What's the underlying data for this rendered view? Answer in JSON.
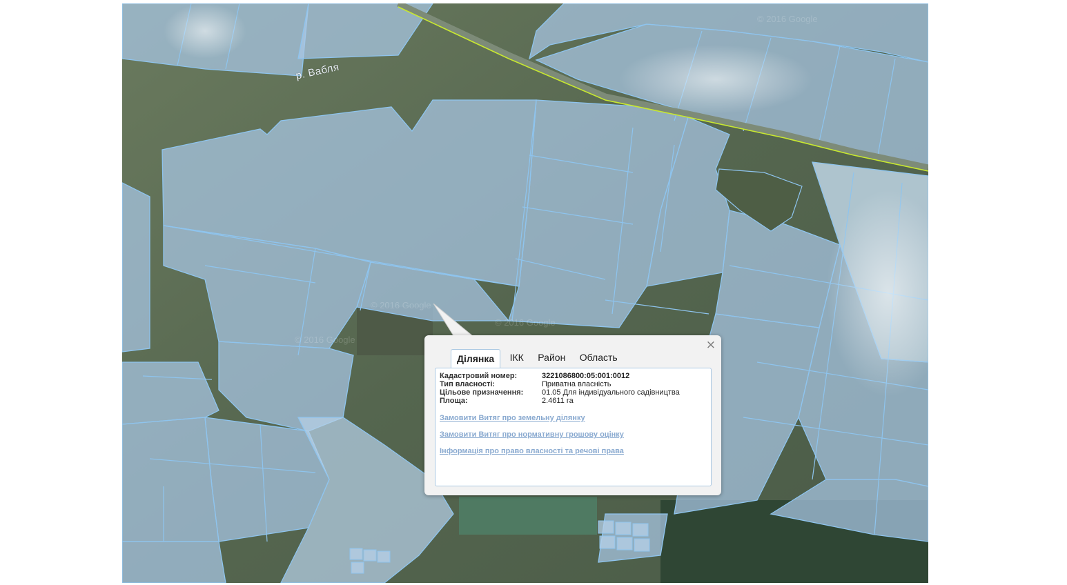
{
  "map": {
    "river_label": "р. Вабля",
    "watermarks": [
      "© 2016 Google",
      "© 2016 Google",
      "© 2016 Google",
      "© 2016 Google"
    ],
    "colors": {
      "parcel_fill": "#a9c8e6",
      "parcel_stroke": "#8ec4ee",
      "road_line": "#c8e830",
      "imagery_dark": "#5b6a55"
    }
  },
  "popup": {
    "close_label": "×",
    "tabs": [
      {
        "label": "Ділянка",
        "active": true
      },
      {
        "label": "ІКК",
        "active": false
      },
      {
        "label": "Район",
        "active": false
      },
      {
        "label": "Область",
        "active": false
      }
    ],
    "info": [
      {
        "key": "Кадастровий номер:",
        "value": "3221086800:05:001:0012"
      },
      {
        "key": "Тип власності:",
        "value": "Приватна власність"
      },
      {
        "key": "Цільове призначення:",
        "value": "01.05 Для індивідуального садівництва"
      },
      {
        "key": "Площа:",
        "value": "2.4611 га"
      }
    ],
    "links": [
      "Замовити Витяг про земельну ділянку",
      "Замовити Витяг про нормативну грошову оцінку",
      "Інформація про право власності та речові права"
    ]
  }
}
